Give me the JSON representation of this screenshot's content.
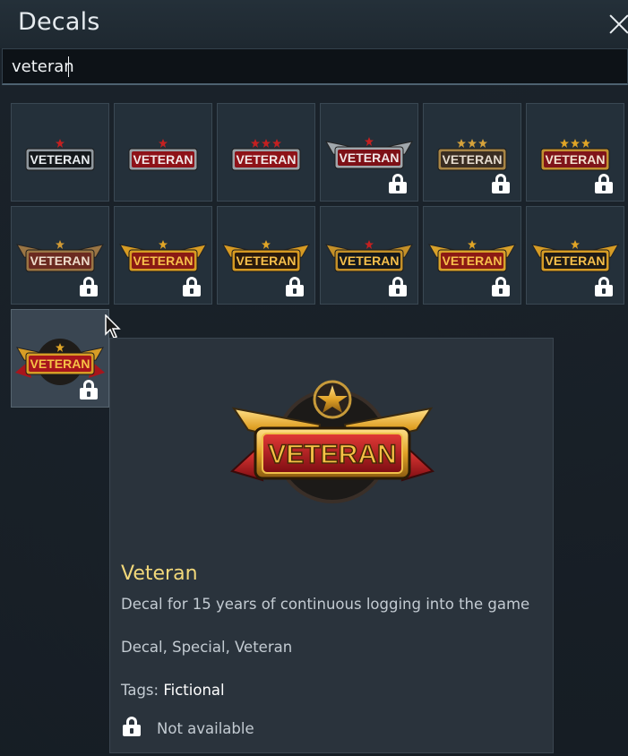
{
  "window": {
    "title": "Decals"
  },
  "search": {
    "value": "veteran"
  },
  "decals": [
    {
      "label": "VETERAN",
      "style": "silver-dark",
      "locked": false
    },
    {
      "label": "VETERAN",
      "style": "silver-red",
      "locked": false
    },
    {
      "label": "VETERAN",
      "style": "silver-red-3star",
      "locked": false
    },
    {
      "label": "VETERAN",
      "style": "silver-red-wings",
      "locked": true
    },
    {
      "label": "VETERAN",
      "style": "bronze-dark",
      "locked": true
    },
    {
      "label": "VETERAN",
      "style": "gold-red",
      "locked": true
    },
    {
      "label": "VETERAN",
      "style": "bronze-shield",
      "locked": true
    },
    {
      "label": "VETERAN",
      "style": "gold-wings",
      "locked": true
    },
    {
      "label": "VETERAN",
      "style": "gold-wings-2",
      "locked": true
    },
    {
      "label": "VETERAN",
      "style": "gold-wings-3",
      "locked": true
    },
    {
      "label": "VETERAN",
      "style": "gold-shield",
      "locked": true
    },
    {
      "label": "VETERAN",
      "style": "gold-red-wings",
      "locked": true
    },
    {
      "label": "VETERAN",
      "style": "gold-laurel-ribbon",
      "locked": true
    }
  ],
  "tooltip": {
    "image_label": "VETERAN",
    "title": "Veteran",
    "description": "Decal for 15 years of continuous logging into the game",
    "categories": "Decal, Special, Veteran",
    "tags_label": "Tags:",
    "tags_value": "Fictional",
    "status": "Not available"
  },
  "colors": {
    "accent_title": "#f2d87a",
    "gold": "#e0a526",
    "red": "#b3121c",
    "silver": "#9aa3aa"
  }
}
